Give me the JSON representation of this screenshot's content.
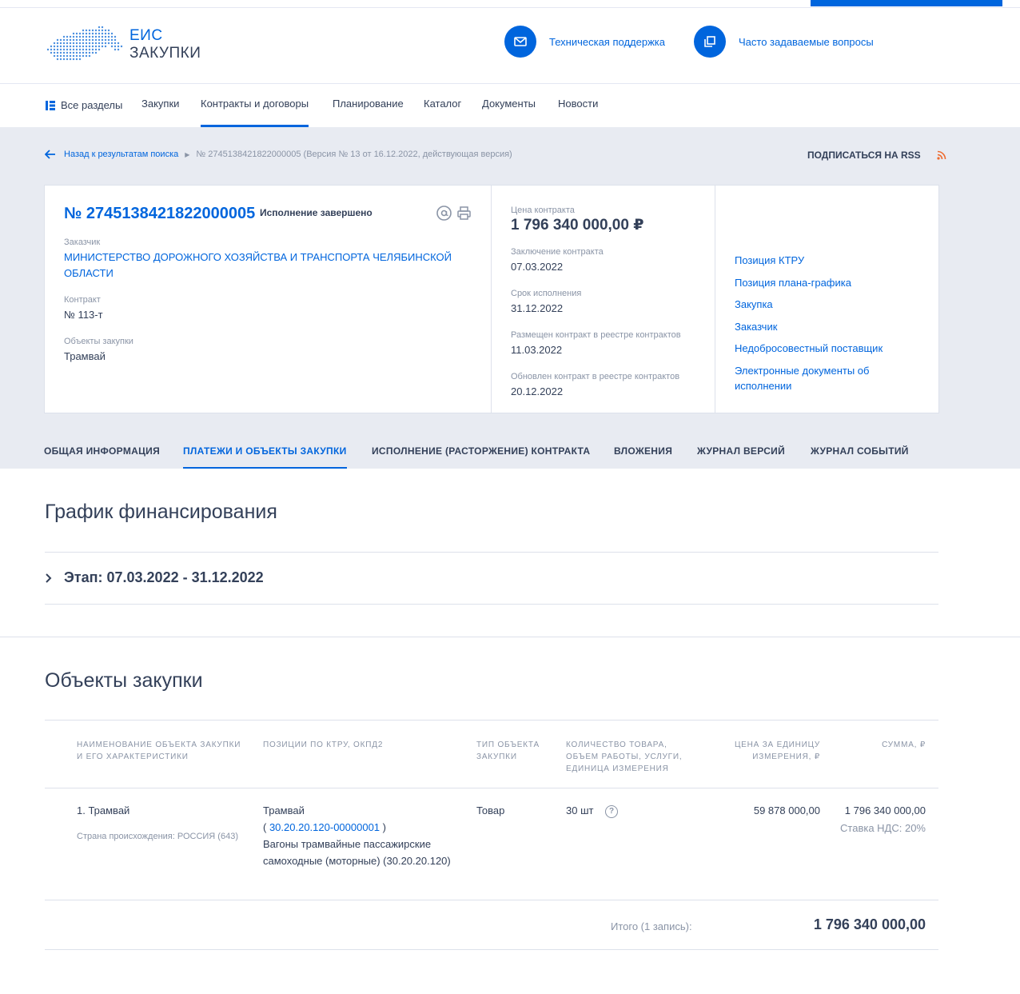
{
  "logo": {
    "line1": "ЕИС",
    "line2": "ЗАКУПКИ"
  },
  "header": {
    "support": "Техническая поддержка",
    "faq": "Часто задаваемые вопросы"
  },
  "nav": {
    "all": "Все разделы",
    "items": [
      "Закупки",
      "Контракты и договоры",
      "Планирование",
      "Каталог",
      "Документы",
      "Новости"
    ],
    "active_index": 1
  },
  "breadcrumb": {
    "back": "Назад к результатам поиска",
    "current": "№ 2745138421822000005 (Версия № 13 от 16.12.2022, действующая версия)"
  },
  "rss": "ПОДПИСАТЬСЯ НА RSS",
  "card": {
    "reg_number": "№ 2745138421822000005",
    "status": "Исполнение завершено",
    "customer_label": "Заказчик",
    "customer": "МИНИСТЕРСТВО ДОРОЖНОГО ХОЗЯЙСТВА И ТРАНСПОРТА ЧЕЛЯБИНСКОЙ ОБЛАСТИ",
    "contract_label": "Контракт",
    "contract": "№ 113-т",
    "objects_label": "Объекты закупки",
    "objects": "Трамвай",
    "price_label": "Цена контракта",
    "price": "1 796 340 000,00 ₽",
    "concluded_label": "Заключение контракта",
    "concluded": "07.03.2022",
    "deadline_label": "Срок исполнения",
    "deadline": "31.12.2022",
    "placed_label": "Размещен контракт в реестре контрактов",
    "placed": "11.03.2022",
    "updated_label": "Обновлен контракт в реестре контрактов",
    "updated": "20.12.2022",
    "links": [
      "Позиция КТРУ",
      "Позиция плана-графика",
      "Закупка",
      "Заказчик",
      "Недобросовестный поставщик",
      "Электронные документы об исполнении"
    ]
  },
  "tabs": [
    "ОБЩАЯ ИНФОРМАЦИЯ",
    "ПЛАТЕЖИ И ОБЪЕКТЫ ЗАКУПКИ",
    "ИСПОЛНЕНИЕ (РАСТОРЖЕНИЕ) КОНТРАКТА",
    "ВЛОЖЕНИЯ",
    "ЖУРНАЛ ВЕРСИЙ",
    "ЖУРНАЛ СОБЫТИЙ"
  ],
  "active_tab": 1,
  "financing": {
    "title": "График финансирования",
    "stage": "Этап: 07.03.2022 - 31.12.2022"
  },
  "objects": {
    "title": "Объекты закупки",
    "columns": [
      "Наименование объекта закупки и его характеристики",
      "Позиции по КТРУ, ОКПД2",
      "Тип объекта закупки",
      "Количество товара, объем работы, услуги, единица измерения",
      "Цена за единицу измерения, ₽",
      "Сумма, ₽"
    ],
    "row": {
      "name": "1. Трамвай",
      "origin": "Страна происхождения: РОССИЯ (643)",
      "ktru_name": "Трамвай",
      "ktru_code": "30.20.20.120-00000001",
      "okpd_desc": "Вагоны трамвайные пассажирские самоходные (моторные) (30.20.20.120)",
      "type": "Товар",
      "qty": "30 шт",
      "unit_price": "59 878 000,00",
      "sum": "1 796 340 000,00",
      "vat": "Ставка НДС: 20%"
    },
    "total_label": "Итого (1 запись):",
    "total": "1 796 340 000,00"
  }
}
